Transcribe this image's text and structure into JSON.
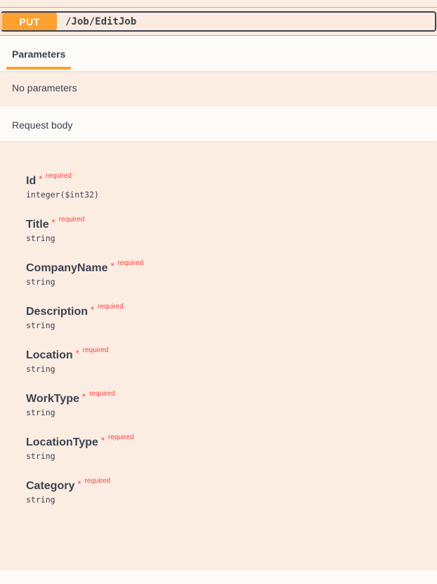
{
  "operation": {
    "method": "PUT",
    "path": "/Job/EditJob"
  },
  "tabs": {
    "parameters_label": "Parameters"
  },
  "parameters": {
    "empty_text": "No parameters"
  },
  "request_body": {
    "label": "Request body"
  },
  "schema": {
    "properties": [
      {
        "name": "Id",
        "star": "*",
        "required": "required",
        "type": "integer($int32)"
      },
      {
        "name": "Title",
        "star": "*",
        "required": "required",
        "type": "string"
      },
      {
        "name": "CompanyName",
        "star": "*",
        "required": "required",
        "type": "string"
      },
      {
        "name": "Description",
        "star": "*",
        "required": "required",
        "type": "string"
      },
      {
        "name": "Location",
        "star": "*",
        "required": "required",
        "type": "string"
      },
      {
        "name": "WorkType",
        "star": "*",
        "required": "required",
        "type": "string"
      },
      {
        "name": "LocationType",
        "star": "*",
        "required": "required",
        "type": "string"
      },
      {
        "name": "Category",
        "star": "*",
        "required": "required",
        "type": "string"
      }
    ]
  },
  "colors": {
    "method_put": "#fca130",
    "required": "#ff3b3b",
    "text": "#3b4151"
  }
}
